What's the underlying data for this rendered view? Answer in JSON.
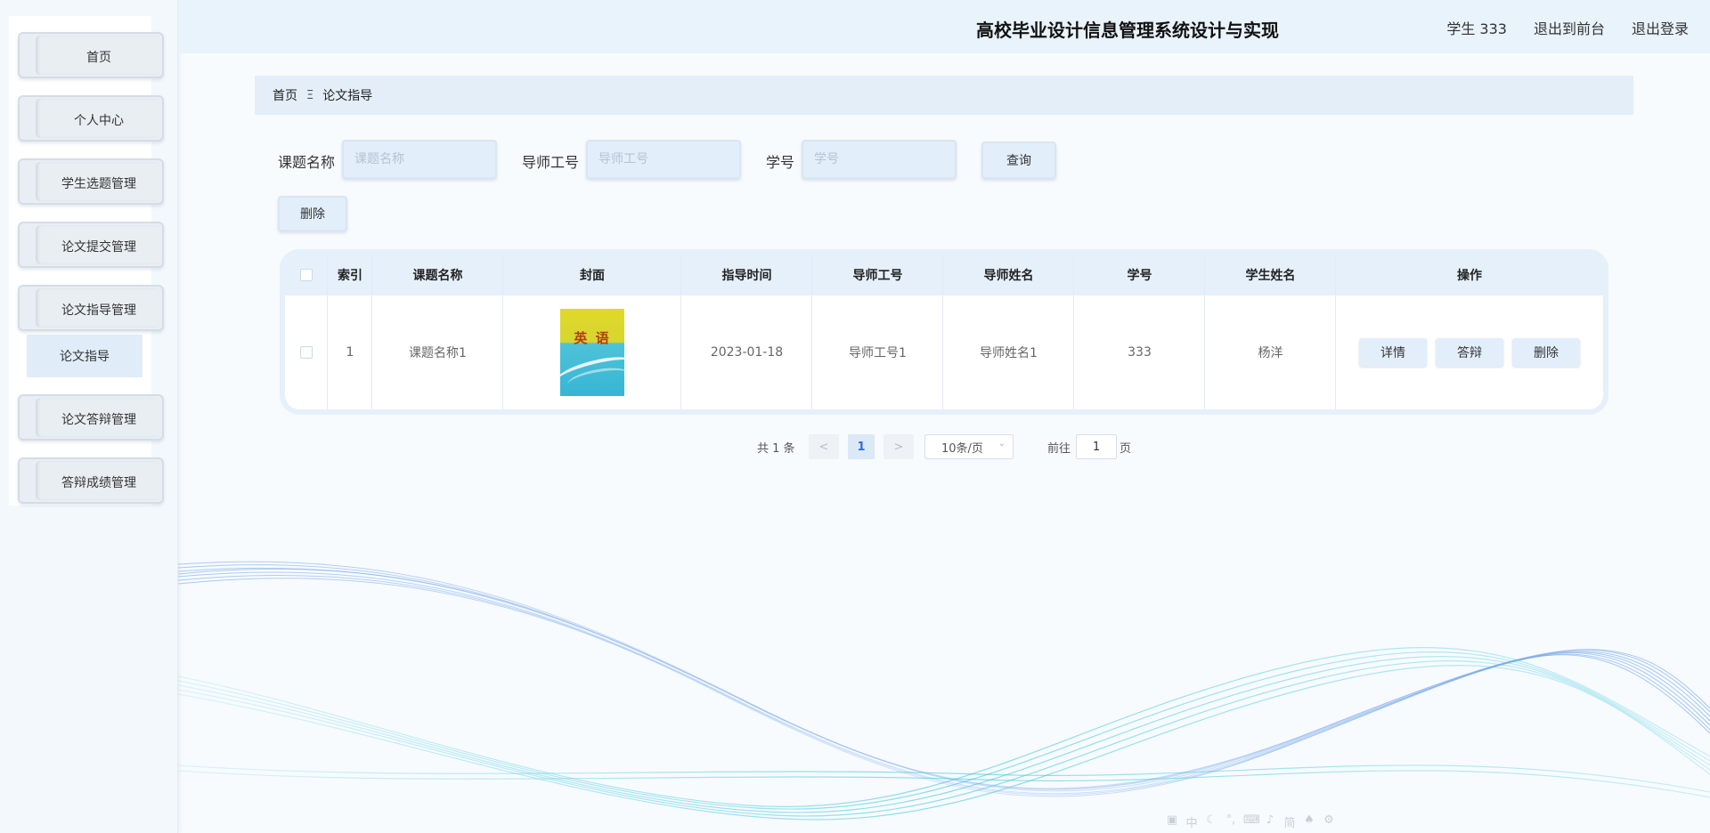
{
  "app": {
    "title": "高校毕业设计信息管理系统设计与实现",
    "user_label": "学生 333",
    "front_link": "退出到前台",
    "logout_link": "退出登录"
  },
  "sidebar": {
    "items": [
      {
        "label": "首页"
      },
      {
        "label": "个人中心"
      },
      {
        "label": "学生选题管理"
      },
      {
        "label": "论文提交管理"
      },
      {
        "label": "论文指导管理"
      },
      {
        "label": "论文答辩管理"
      },
      {
        "label": "答辩成绩管理"
      }
    ],
    "active_sub": "论文指导"
  },
  "breadcrumb": {
    "home": "首页",
    "separator": "Ξ",
    "current": "论文指导"
  },
  "search": {
    "topic_label": "课题名称",
    "topic_placeholder": "课题名称",
    "tutor_label": "导师工号",
    "tutor_placeholder": "导师工号",
    "student_label": "学号",
    "student_placeholder": "学号",
    "query_button": "查询",
    "delete_button": "删除"
  },
  "table": {
    "headers": {
      "index": "索引",
      "topic": "课题名称",
      "cover": "封面",
      "time": "指导时间",
      "tutor_id": "导师工号",
      "tutor_name": "导师姓名",
      "student_id": "学号",
      "student_name": "学生姓名",
      "action": "操作"
    },
    "rows": [
      {
        "index": "1",
        "topic": "课题名称1",
        "cover_title": "英 语",
        "time": "2023-01-18",
        "tutor_id": "导师工号1",
        "tutor_name": "导师姓名1",
        "student_id": "333",
        "student_name": "杨洋",
        "actions": [
          "详情",
          "答辩",
          "删除"
        ]
      }
    ]
  },
  "pagination": {
    "total": "共 1 条",
    "prev": "<",
    "current_page": "1",
    "next": ">",
    "page_size": "10条/页",
    "goto_label": "前往",
    "goto_value": "1",
    "page_suffix": "页"
  },
  "colors": {
    "accent": "#e2eefa",
    "header_bg": "#e9f3fb",
    "wave_blue": "#6b9ee8",
    "wave_cyan": "#3ec4dc"
  }
}
